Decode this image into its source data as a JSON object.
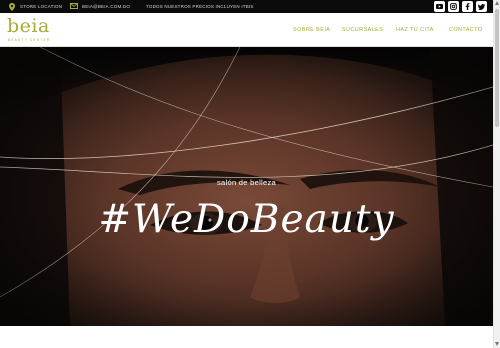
{
  "topbar": {
    "location": "STORE LOCATION",
    "email": "BEIA@BEIA.COM.DO",
    "promo": "TODOS NUESTROS PRECIOS INCLUYEN ITBIS",
    "social": [
      "youtube-icon",
      "instagram-icon",
      "facebook-icon",
      "twitter-icon"
    ]
  },
  "logo": {
    "word": "beia",
    "sub": "BEAUTY CENTER"
  },
  "nav": {
    "items": [
      "SOBRE BEIA",
      "SUCURSALES",
      "HAZ TU CITA",
      "CONTACTO"
    ]
  },
  "hero": {
    "kicker": "salón de belleza",
    "tagline": "#WeDoBeauty"
  },
  "colors": {
    "accent": "#a8ab36",
    "topbar_bg": "#0b0b0b"
  }
}
